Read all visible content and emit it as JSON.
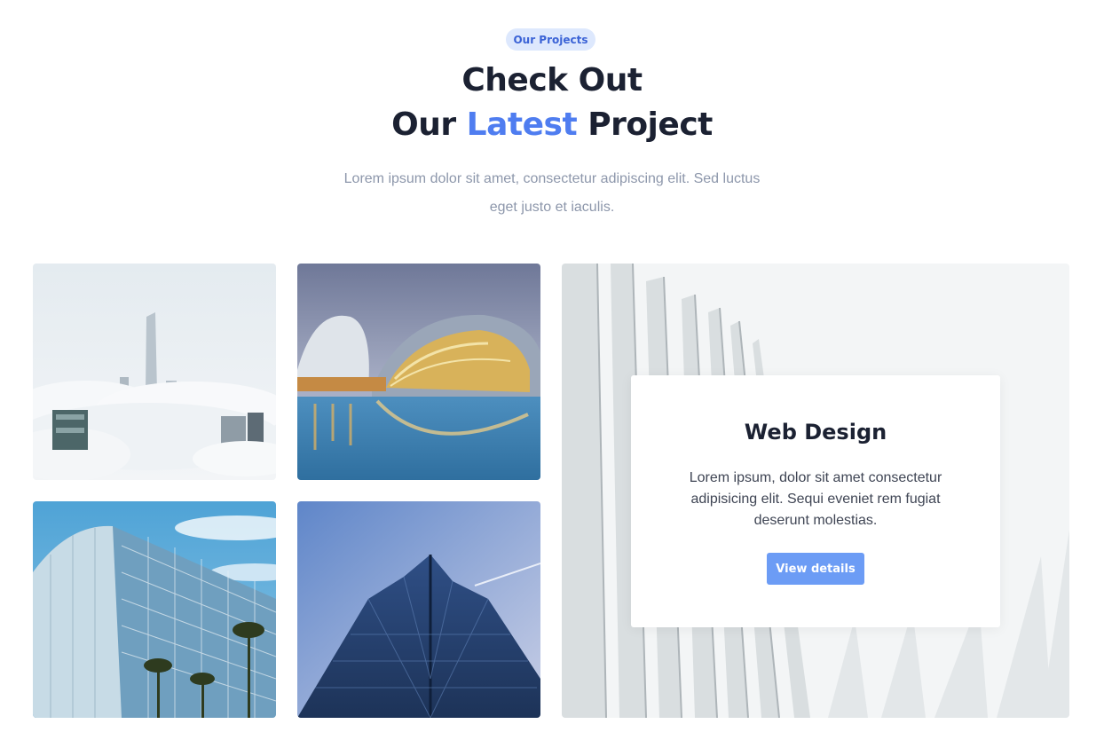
{
  "section": {
    "badge": "Our Projects",
    "title_line1": "Check Out",
    "title_line2_before": "Our ",
    "title_line2_accent": "Latest",
    "title_line2_after": " Project",
    "subtitle": "Lorem ipsum dolor sit amet, consectetur adipiscing elit. Sed luctus eget justo et iaculis."
  },
  "gallery": {
    "images": [
      {
        "subject": "city-skyline-above-clouds"
      },
      {
        "subject": "futuristic-architecture-reflection"
      },
      {
        "subject": "glass-office-building-with-palms"
      },
      {
        "subject": "skyscraper-low-angle"
      },
      {
        "subject": "white-modern-architecture"
      }
    ]
  },
  "featured": {
    "title": "Web Design",
    "description": "Lorem ipsum, dolor sit amet consectetur adipisicing elit. Sequi eveniet rem fugiat deserunt molestias.",
    "button_label": "View details"
  },
  "colors": {
    "accent": "#4f7df0",
    "badge_bg": "#dde8fd",
    "button": "#6c9cf5",
    "heading": "#1b2132",
    "muted": "#8d97ab"
  }
}
